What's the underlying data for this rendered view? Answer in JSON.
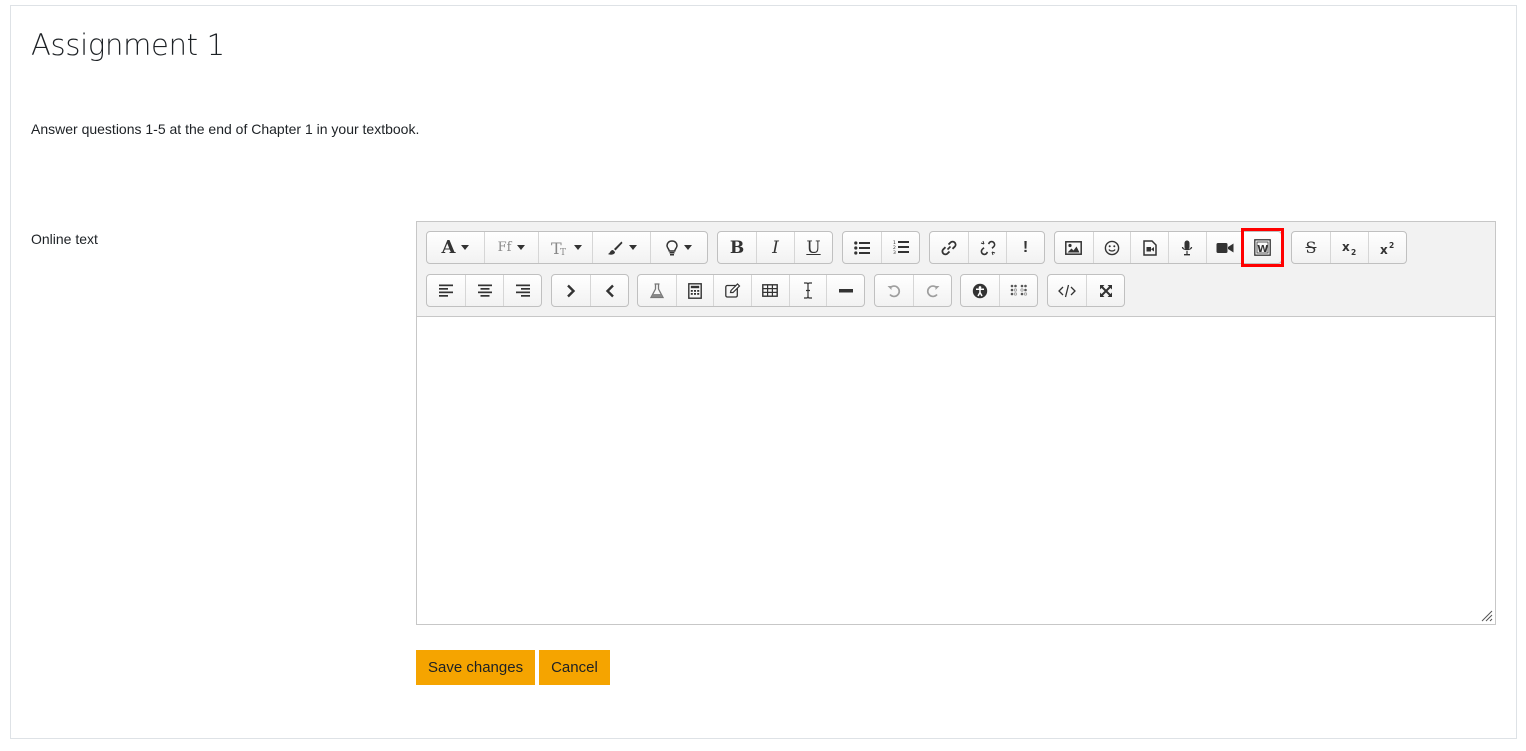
{
  "page": {
    "title": "Assignment 1",
    "intro": "Answer questions 1-5 at the end of Chapter 1 in your textbook.",
    "field_label": "Online text"
  },
  "toolbar": {
    "row1": [
      {
        "name": "font-color-menu",
        "icon": "font-icon"
      },
      {
        "name": "font-family-menu",
        "icon": "font-family-icon",
        "label": "Ff"
      },
      {
        "name": "font-size-menu",
        "icon": "font-size-icon"
      },
      {
        "name": "background-color-menu",
        "icon": "paintbrush-icon"
      },
      {
        "name": "styles-menu",
        "icon": "lightbulb-icon"
      },
      {
        "name": "bold",
        "icon": "bold-icon",
        "label": "B"
      },
      {
        "name": "italic",
        "icon": "italic-icon",
        "label": "I"
      },
      {
        "name": "underline",
        "icon": "underline-icon",
        "label": "U"
      },
      {
        "name": "unordered-list",
        "icon": "bullet-list-icon"
      },
      {
        "name": "ordered-list",
        "icon": "numbered-list-icon"
      },
      {
        "name": "link",
        "icon": "link-icon"
      },
      {
        "name": "unlink",
        "icon": "unlink-icon"
      },
      {
        "name": "emphasis",
        "icon": "exclamation-icon",
        "label": "!"
      },
      {
        "name": "image",
        "icon": "image-icon"
      },
      {
        "name": "emoticon",
        "icon": "smiley-icon"
      },
      {
        "name": "media",
        "icon": "file-video-icon"
      },
      {
        "name": "record-audio",
        "icon": "microphone-icon"
      },
      {
        "name": "record-video",
        "icon": "video-camera-icon"
      },
      {
        "name": "word-import",
        "icon": "word-import-icon",
        "label": "W",
        "highlighted": true
      },
      {
        "name": "strikethrough",
        "icon": "strikethrough-icon",
        "label": "S"
      },
      {
        "name": "subscript",
        "icon": "subscript-icon"
      },
      {
        "name": "superscript",
        "icon": "superscript-icon"
      }
    ],
    "row2": [
      "align-left",
      "align-center",
      "align-right",
      "indent",
      "outdent",
      "chemistry",
      "equation",
      "templates",
      "table",
      "clear-formatting",
      "horizontal-rule",
      "undo",
      "redo",
      "accessibility-checker",
      "screenreader-helper",
      "html-source",
      "fullscreen"
    ],
    "highlight_color": "#ff0000"
  },
  "actions": {
    "save_label": "Save changes",
    "cancel_label": "Cancel",
    "accent_color": "#f5a400"
  }
}
